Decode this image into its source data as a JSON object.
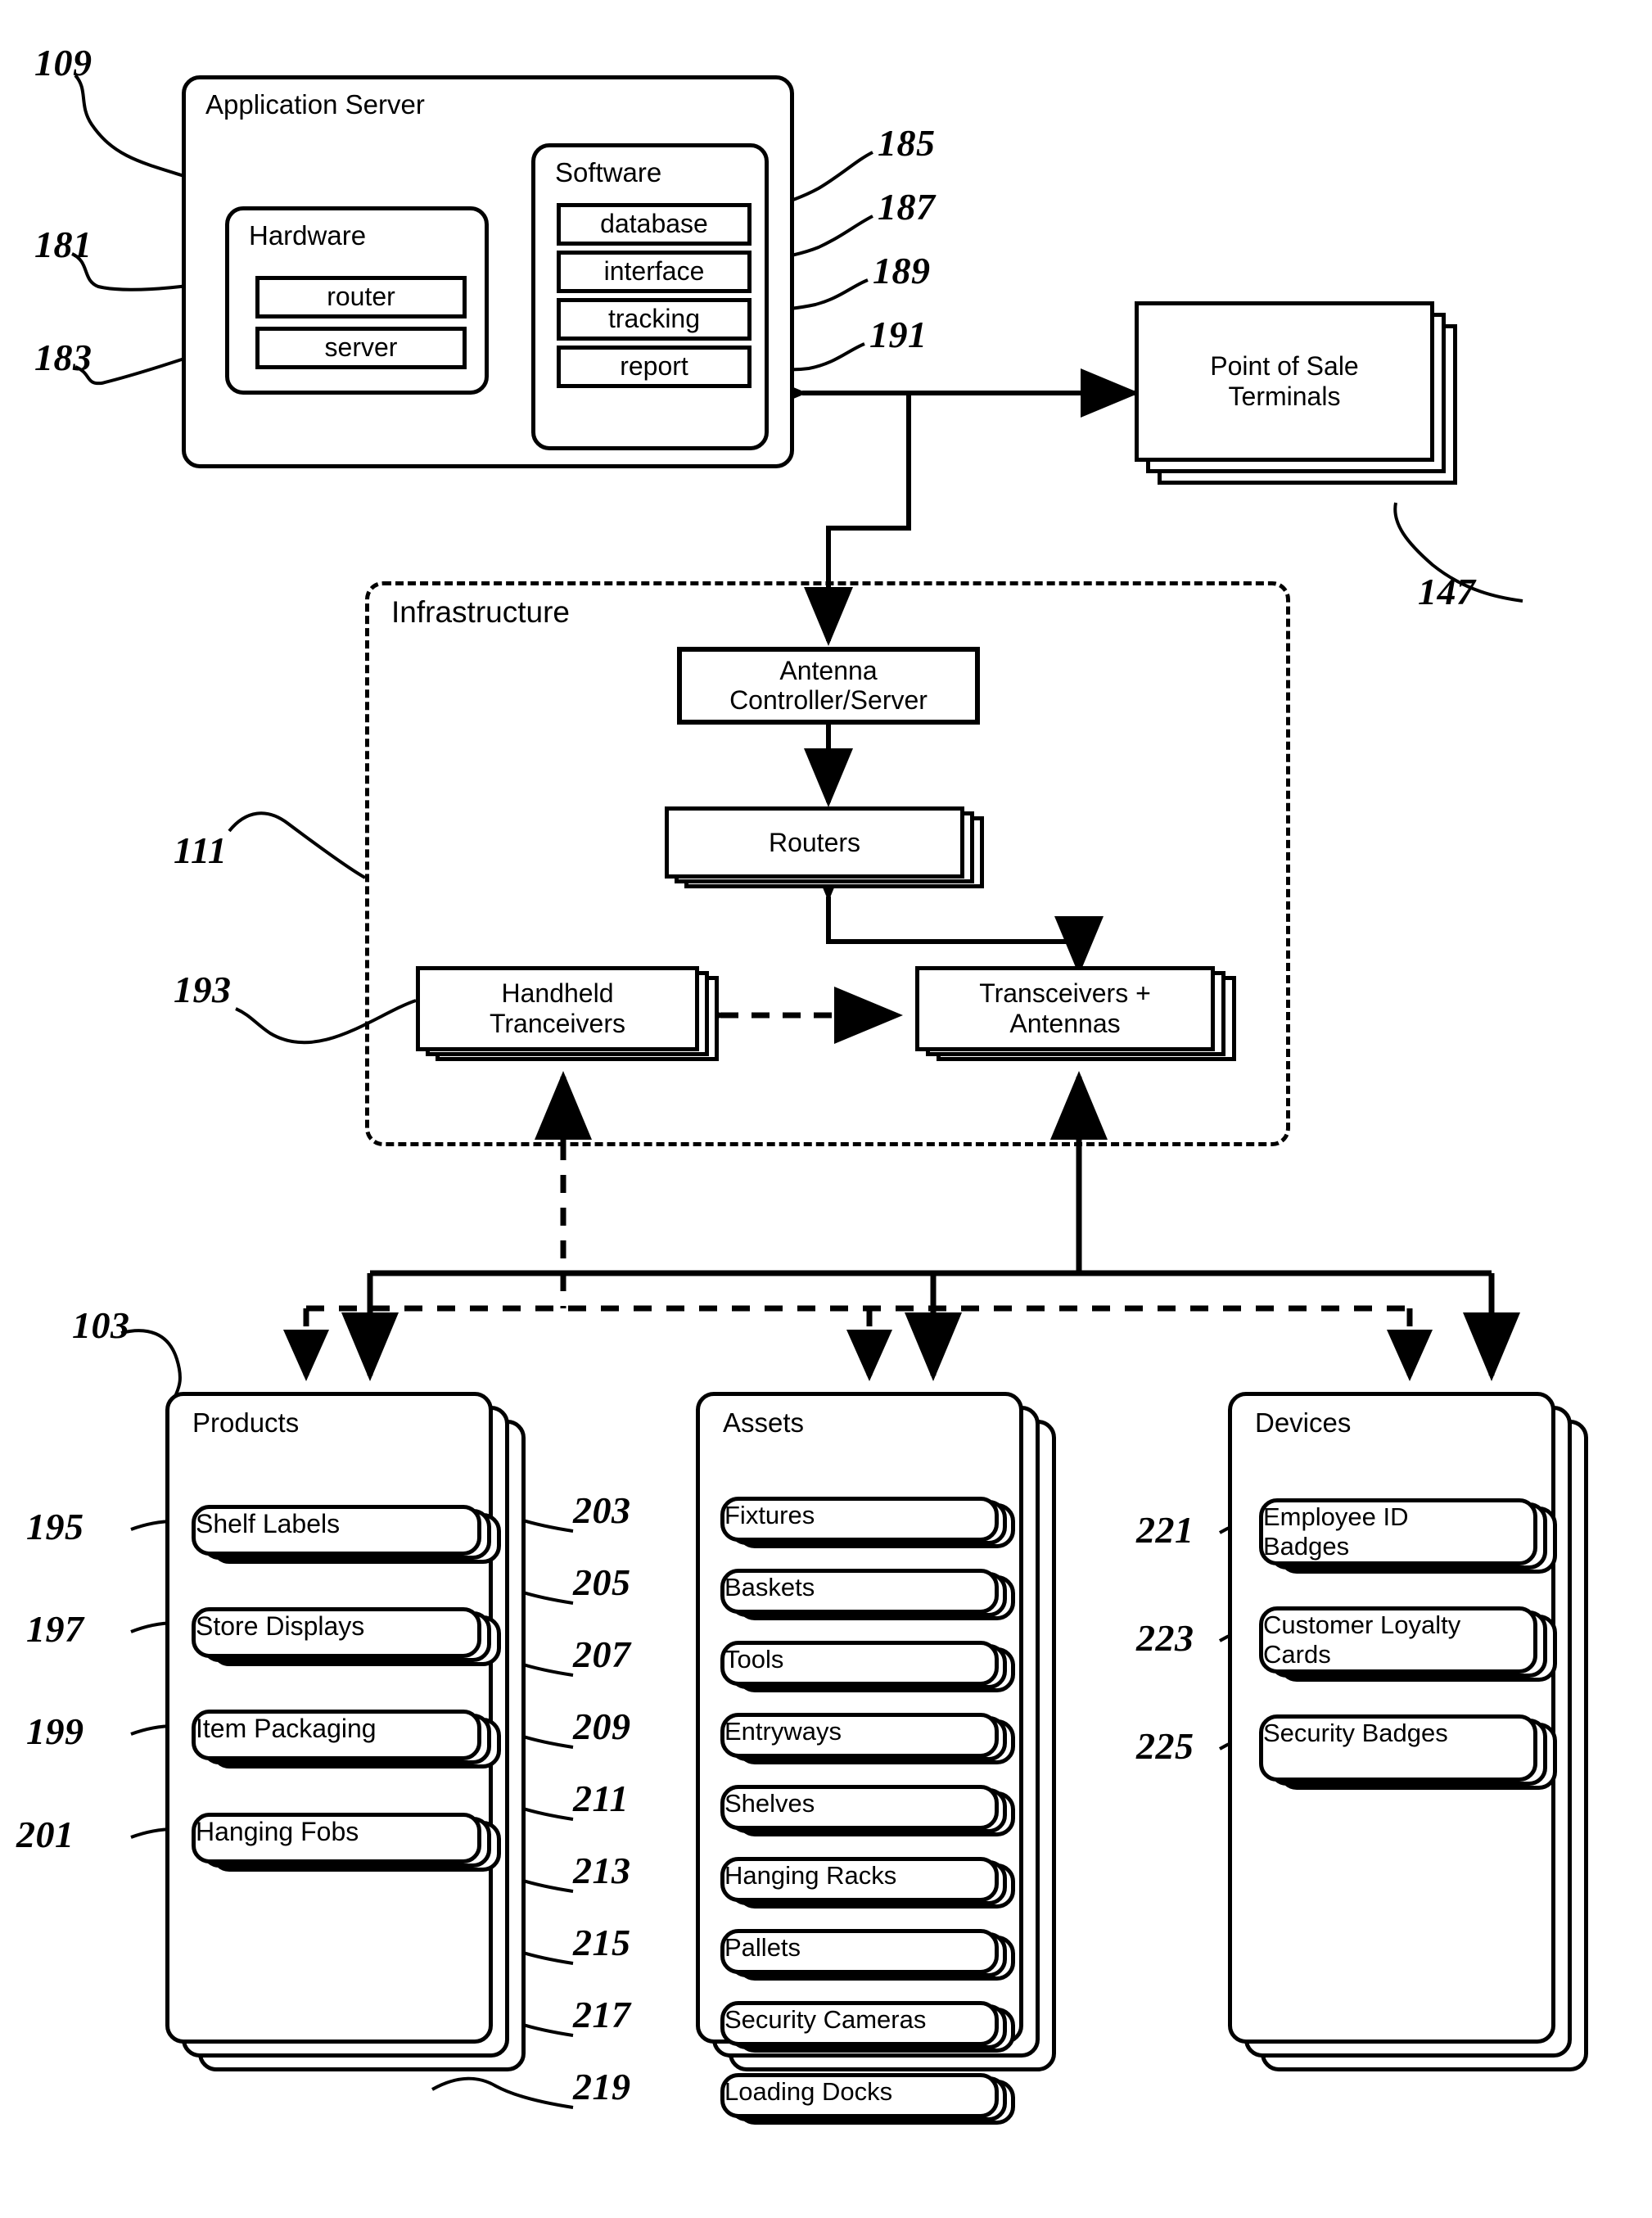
{
  "figure": {
    "type": "patent-block-diagram",
    "background": "#ffffff",
    "line_color": "#000000"
  },
  "application_server": {
    "title": "Application Server",
    "ref": "109",
    "hardware": {
      "title": "Hardware",
      "items": [
        {
          "label": "router",
          "ref": "181"
        },
        {
          "label": "server",
          "ref": "183"
        }
      ]
    },
    "software": {
      "title": "Software",
      "items": [
        {
          "label": "database",
          "ref": "185"
        },
        {
          "label": "interface",
          "ref": "187"
        },
        {
          "label": "tracking",
          "ref": "189"
        },
        {
          "label": "report",
          "ref": "191"
        }
      ]
    }
  },
  "pos_terminals": {
    "label_line1": "Point of Sale",
    "label_line2": "Terminals",
    "ref": "147"
  },
  "infrastructure": {
    "title": "Infrastructure",
    "ref": "111",
    "antenna_controller": {
      "label_line1": "Antenna",
      "label_line2": "Controller/Server"
    },
    "routers": {
      "label": "Routers"
    },
    "handheld": {
      "label_line1": "Handheld",
      "label_line2": "Tranceivers",
      "ref": "193"
    },
    "transceivers": {
      "label_line1": "Transceivers +",
      "label_line2": "Antennas"
    }
  },
  "columns": [
    {
      "title": "Products",
      "ref": "103",
      "items": [
        {
          "label": "Shelf Labels",
          "ref": "195"
        },
        {
          "label": "Store Displays",
          "ref": "197"
        },
        {
          "label": "Item Packaging",
          "ref": "199"
        },
        {
          "label": "Hanging Fobs",
          "ref": "201"
        }
      ]
    },
    {
      "title": "Assets",
      "ref": "",
      "items": [
        {
          "label": "Fixtures",
          "ref": "203"
        },
        {
          "label": "Baskets",
          "ref": "205"
        },
        {
          "label": "Tools",
          "ref": "207"
        },
        {
          "label": "Entryways",
          "ref": "209"
        },
        {
          "label": "Shelves",
          "ref": "211"
        },
        {
          "label": "Hanging Racks",
          "ref": "213"
        },
        {
          "label": "Pallets",
          "ref": "215"
        },
        {
          "label": "Security Cameras",
          "ref": "217"
        },
        {
          "label": "Loading Docks",
          "ref": "219"
        }
      ]
    },
    {
      "title": "Devices",
      "ref": "",
      "items": [
        {
          "label_line1": "Employee ID",
          "label_line2": "Badges",
          "ref": "221"
        },
        {
          "label_line1": "Customer Loyalty",
          "label_line2": "Cards",
          "ref": "223"
        },
        {
          "label_line1": "Security Badges",
          "label_line2": "",
          "ref": "225"
        }
      ]
    }
  ]
}
